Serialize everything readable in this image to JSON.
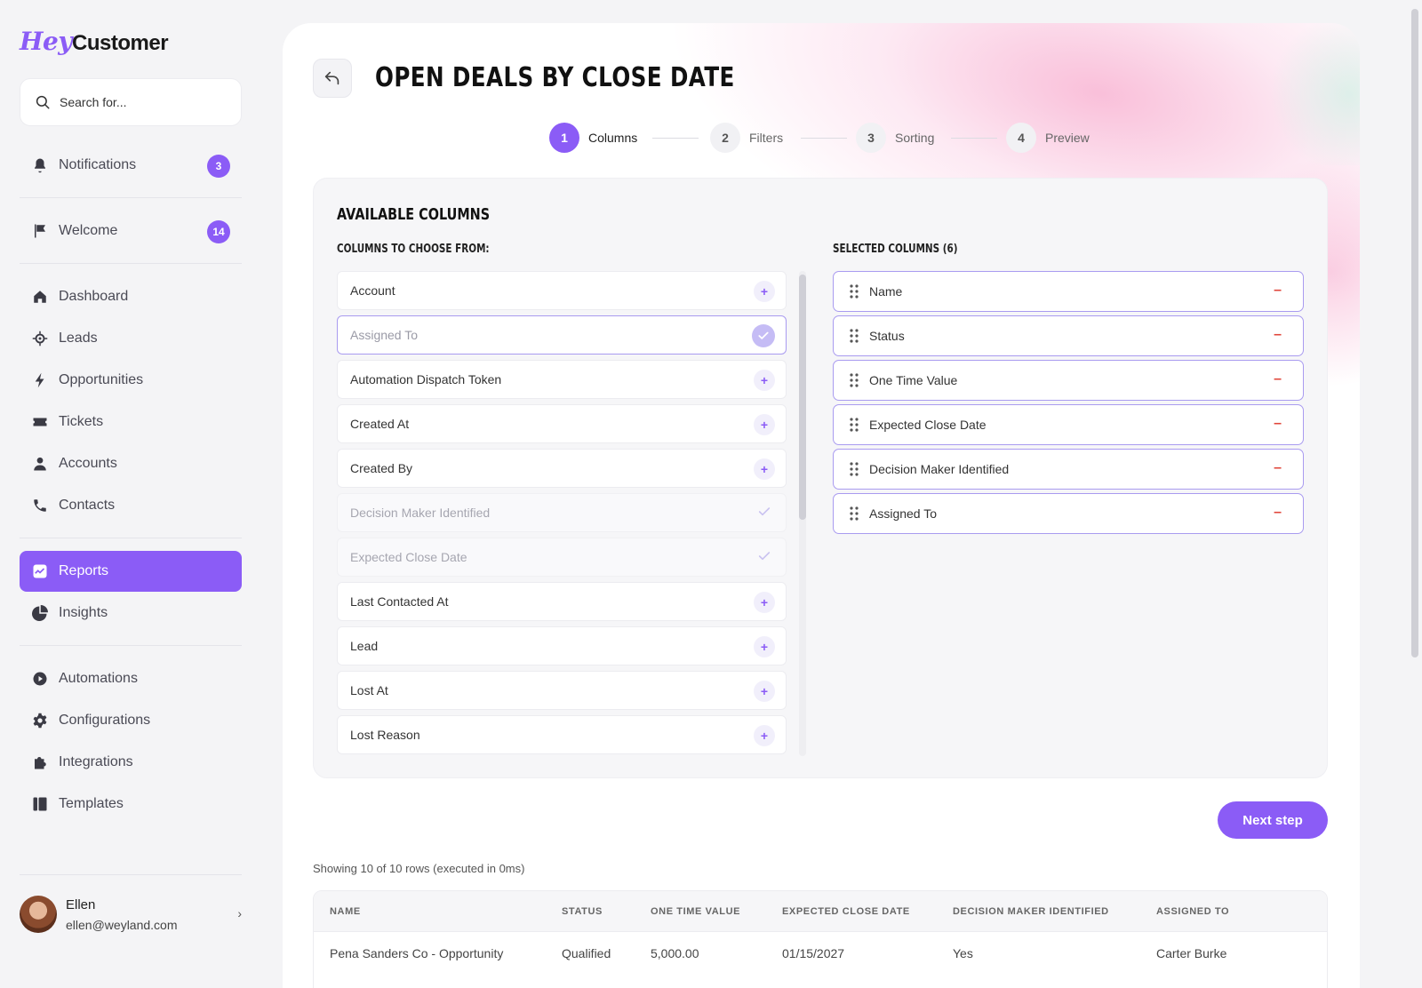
{
  "app": {
    "logo_hey": "Hey",
    "logo_customer": "Customer"
  },
  "search": {
    "placeholder": "Search for..."
  },
  "sidebar": {
    "notifications": {
      "label": "Notifications",
      "badge": "3"
    },
    "welcome": {
      "label": "Welcome",
      "badge": "14"
    },
    "items": [
      {
        "label": "Dashboard",
        "icon": "home-icon"
      },
      {
        "label": "Leads",
        "icon": "target-icon"
      },
      {
        "label": "Opportunities",
        "icon": "bolt-icon"
      },
      {
        "label": "Tickets",
        "icon": "ticket-icon"
      },
      {
        "label": "Accounts",
        "icon": "person-icon"
      },
      {
        "label": "Contacts",
        "icon": "phone-icon"
      },
      {
        "label": "Reports",
        "icon": "chart-icon",
        "active": true
      },
      {
        "label": "Insights",
        "icon": "pie-icon"
      },
      {
        "label": "Automations",
        "icon": "play-icon"
      },
      {
        "label": "Configurations",
        "icon": "gear-icon"
      },
      {
        "label": "Integrations",
        "icon": "puzzle-icon"
      },
      {
        "label": "Templates",
        "icon": "template-icon"
      }
    ],
    "user": {
      "name": "Ellen",
      "email": "ellen@weyland.com"
    }
  },
  "page": {
    "title": "OPEN DEALS BY CLOSE DATE",
    "steps": [
      {
        "num": "1",
        "label": "Columns",
        "active": true
      },
      {
        "num": "2",
        "label": "Filters"
      },
      {
        "num": "3",
        "label": "Sorting"
      },
      {
        "num": "4",
        "label": "Preview"
      }
    ]
  },
  "columns": {
    "title": "AVAILABLE COLUMNS",
    "choose_heading": "COLUMNS TO CHOOSE FROM:",
    "selected_heading": "SELECTED COLUMNS (6)",
    "available": [
      {
        "label": "Account",
        "state": "add"
      },
      {
        "label": "Assigned To",
        "state": "selected"
      },
      {
        "label": "Automation Dispatch Token",
        "state": "add"
      },
      {
        "label": "Created At",
        "state": "add"
      },
      {
        "label": "Created By",
        "state": "add"
      },
      {
        "label": "Decision Maker Identified",
        "state": "muted"
      },
      {
        "label": "Expected Close Date",
        "state": "muted"
      },
      {
        "label": "Last Contacted At",
        "state": "add"
      },
      {
        "label": "Lead",
        "state": "add"
      },
      {
        "label": "Lost At",
        "state": "add"
      },
      {
        "label": "Lost Reason",
        "state": "add"
      }
    ],
    "selected": [
      "Name",
      "Status",
      "One Time Value",
      "Expected Close Date",
      "Decision Maker Identified",
      "Assigned To"
    ],
    "plus_symbol": "+",
    "minus_symbol": "–"
  },
  "actions": {
    "next_step": "Next step"
  },
  "results": {
    "info": "Showing 10 of 10 rows (executed in 0ms)",
    "headers": [
      "NAME",
      "STATUS",
      "ONE TIME VALUE",
      "EXPECTED CLOSE DATE",
      "DECISION MAKER IDENTIFIED",
      "ASSIGNED TO"
    ],
    "rows": [
      [
        "Pena Sanders Co - Opportunity",
        "Qualified",
        "5,000.00",
        "01/15/2027",
        "Yes",
        "Carter Burke"
      ]
    ]
  },
  "colors": {
    "accent": "#8b5cf6",
    "danger": "#e0453a"
  }
}
